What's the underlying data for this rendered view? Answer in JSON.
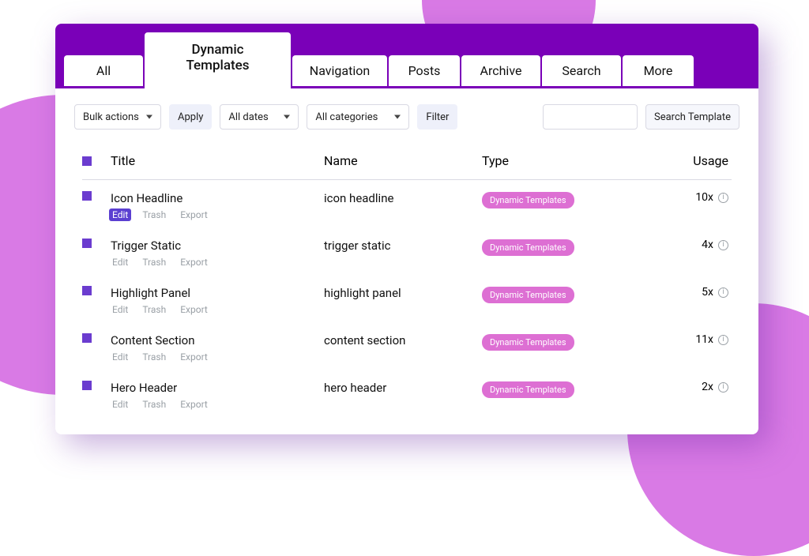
{
  "tabs": [
    "All",
    "Dynamic Templates",
    "Navigation",
    "Posts",
    "Archive",
    "Search",
    "More"
  ],
  "active_tab": 1,
  "toolbar": {
    "bulk_actions": "Bulk actions",
    "apply": "Apply",
    "all_dates": "All dates",
    "all_categories": "All categories",
    "filter": "Filter",
    "search_button": "Search Template"
  },
  "columns": {
    "title": "Title",
    "name": "Name",
    "type": "Type",
    "usage": "Usage"
  },
  "type_pill": "Dynamic Templates",
  "row_actions": {
    "edit": "Edit",
    "trash": "Trash",
    "export": "Export"
  },
  "rows": [
    {
      "title": "Icon Headline",
      "name": "icon headline",
      "usage": "10x",
      "highlight_edit": true
    },
    {
      "title": "Trigger Static",
      "name": "trigger static",
      "usage": "4x",
      "highlight_edit": false
    },
    {
      "title": "Highlight Panel",
      "name": "highlight panel",
      "usage": "5x",
      "highlight_edit": false
    },
    {
      "title": "Content Section",
      "name": "content section",
      "usage": "11x",
      "highlight_edit": false
    },
    {
      "title": "Hero Header",
      "name": "hero header",
      "usage": "2x",
      "highlight_edit": false
    }
  ]
}
